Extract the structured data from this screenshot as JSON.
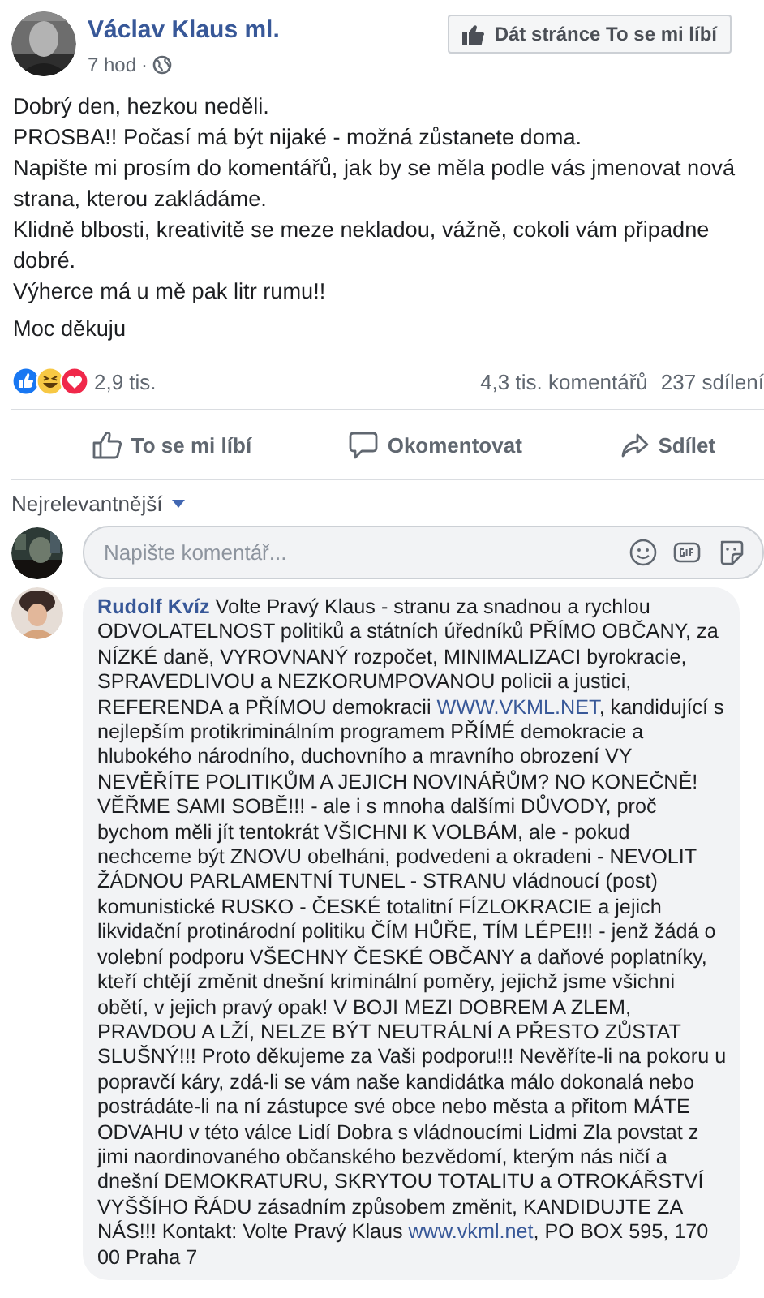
{
  "post": {
    "author": "Václav Klaus ml.",
    "time": "7 hod",
    "separator": "·",
    "like_page_button": "Dát stránce To se mi líbí",
    "paragraphs": [
      "Dobrý den, hezkou neděli.\nPROSBA!! Počasí má být nijaké - možná zůstanete doma.\nNapište mi prosím do komentářů, jak by se měla podle vás jmenovat nová strana, kterou zakládáme.\nKlidně blbosti, kreativitě se meze nekladou, vážně, cokoli vám připadne dobré.\nVýherce má u mě pak litr rumu!!",
      "Moc děkuju"
    ]
  },
  "stats": {
    "reactions": [
      {
        "kind": "like"
      },
      {
        "kind": "haha"
      },
      {
        "kind": "love"
      }
    ],
    "reaction_count": "2,9 tis.",
    "comments": "4,3 tis. komentářů",
    "shares": "237 sdílení"
  },
  "actions": [
    {
      "kind": "like",
      "label": "To se mi líbí"
    },
    {
      "kind": "comment",
      "label": "Okomentovat"
    },
    {
      "kind": "share",
      "label": "Sdílet"
    }
  ],
  "sort": {
    "label": "Nejrelevantnější"
  },
  "comment_box": {
    "placeholder": "Napište komentář..."
  },
  "comments": [
    {
      "author": "Rudolf Kvíz",
      "segments": [
        {
          "kind": "text",
          "text": "Volte Pravý Klaus - stranu za snadnou a rychlou ODVOLATELNOST politiků a státních úředníků PŘÍMO OBČANY, za NÍZKÉ daně, VYROVNANÝ rozpočet, MINIMALIZACI byrokracie, SPRAVEDLIVOU a NEZKORUMPOVANOU policii a justici, REFERENDA a PŘÍMOU demokracii "
        },
        {
          "kind": "link",
          "text": "WWW.VKML.NET"
        },
        {
          "kind": "text",
          "text": ", kandidující s nejlepším protikriminálním programem PŘÍMÉ demokracie a hlubokého národního, duchovního a mravního obrození VY NEVĚŘÍTE POLITIKŮM A JEJICH NOVINÁŘŮM? NO KONEČNĚ! VĚŘME SAMI SOBĚ!!! - ale i s mnoha dalšími DŮVODY, proč bychom měli jít tentokrát VŠICHNI K VOLBÁM, ale - pokud nechceme být ZNOVU obelháni, podvedeni a okradeni - NEVOLIT ŽÁDNOU PARLAMENTNÍ TUNEL - STRANU vládnoucí (post) komunistické RUSKO - ČESKÉ totalitní FÍZLOKRACIE a jejich likvidační protinárodní politiku ČÍM HŮŘE, TÍM LÉPE!!! - jenž žádá o volební podporu VŠECHNY ČESKÉ OBČANY a daňové poplatníky, kteří chtějí změnit dnešní kriminální poměry, jejichž jsme všichni obětí, v jejich pravý opak! V BOJI MEZI DOBREM A ZLEM, PRAVDOU A LŽÍ, NELZE BÝT NEUTRÁLNÍ A PŘESTO ZŮSTAT SLUŠNÝ!!! Proto děkujeme za Vaši podporu!!! Nevěříte-li na pokoru u popravčí káry, zdá-li se vám naše kandidátka málo dokonalá nebo postrádáte-li na ní zástupce své obce nebo města a přitom MÁTE ODVAHU v této válce Lidí Dobra s vládnoucími Lidmi Zla povstat z jimi naordinovaného občanského bezvědomí, kterým nás ničí a dnešní DEMOKRATURU, SKRYTOU TOTALITU a OTROKÁŘSTVÍ VYŠŠÍHO ŘÁDU zásadním způsobem změnit, KANDIDUJTE ZA NÁS!!! Kontakt: Volte Pravý Klaus "
        },
        {
          "kind": "link",
          "text": "www.vkml.net"
        },
        {
          "kind": "text",
          "text": ", PO BOX 595, 170 00 Praha 7"
        }
      ]
    }
  ]
}
